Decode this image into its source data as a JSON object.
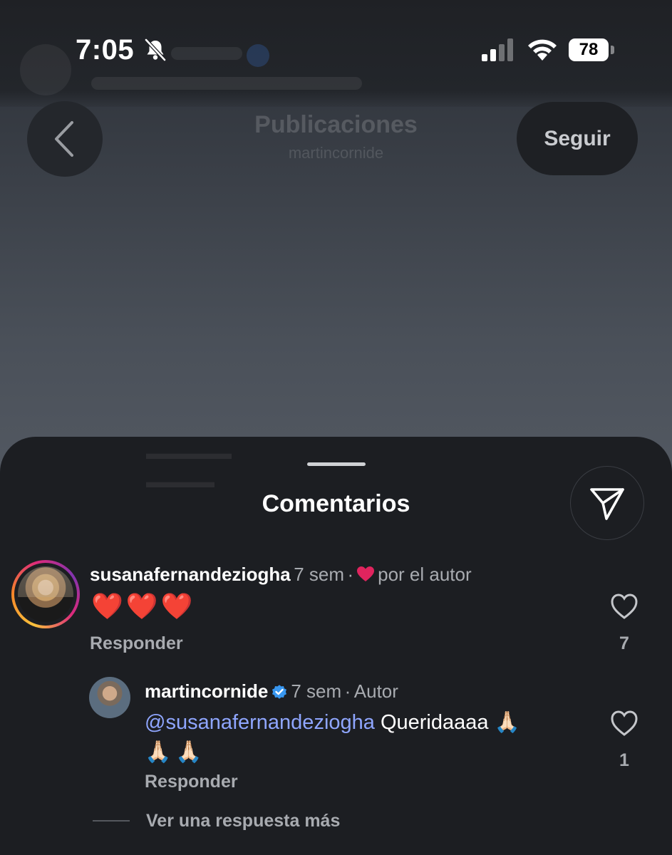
{
  "status_bar": {
    "time": "7:05",
    "battery_level": "78",
    "icons": [
      "bell-slash-icon",
      "cellular-signal-icon",
      "wifi-icon",
      "battery-icon"
    ]
  },
  "post_header": {
    "title": "Publicaciones",
    "subtitle": "martincornide",
    "follow_label": "Seguir",
    "back_icon": "chevron-left-icon"
  },
  "comments_sheet": {
    "title": "Comentarios",
    "share_icon": "paper-plane-icon",
    "comments": [
      {
        "username": "susanafernandeziogha",
        "time": "7 sem",
        "liked_by_author_label": "por el autor",
        "text": "❤️❤️❤️",
        "reply_label": "Responder",
        "like_count": "7"
      },
      {
        "username": "martincornide",
        "time": "7 sem",
        "author_label": "Autor",
        "mention": "@susanafernandeziogha",
        "text": " Queridaaaa 🙏🏻",
        "text_line2": "🙏🏻🙏🏻",
        "reply_label": "Responder",
        "like_count": "1"
      }
    ],
    "more_replies_label": "Ver una respuesta más"
  },
  "colors": {
    "background": "#1c1e22",
    "mention": "#8fa6ff",
    "heart_red": "#e0245e",
    "verified_blue": "#3897f0",
    "muted_text": "#a8abb0"
  }
}
